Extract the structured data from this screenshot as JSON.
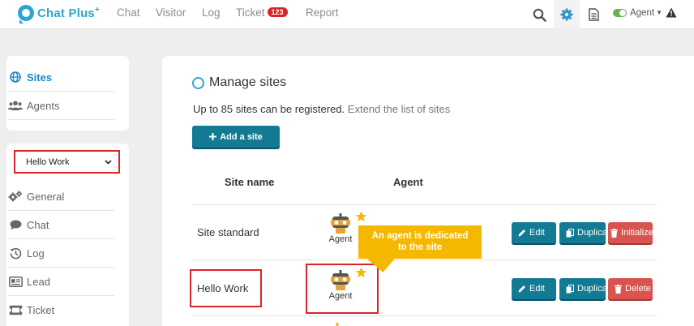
{
  "app": {
    "logo_text": "Chat Plus",
    "logo_sup": "+"
  },
  "nav": [
    {
      "label": "Chat"
    },
    {
      "label": "Visitor"
    },
    {
      "label": "Log"
    },
    {
      "label": "Ticket",
      "badge": "123"
    },
    {
      "label": "Report"
    }
  ],
  "toolbar": {
    "agent_label": "Agent",
    "icons": [
      "search-icon",
      "gear-icon",
      "document-icon",
      "warning-icon"
    ]
  },
  "sidebar_top": [
    {
      "label": "Sites",
      "icon": "globe-icon",
      "active": true
    },
    {
      "label": "Agents",
      "icon": "users-icon"
    }
  ],
  "site_select": {
    "value": "Hello Work"
  },
  "sidebar_menu": [
    {
      "label": "General",
      "icon": "gears-icon"
    },
    {
      "label": "Chat",
      "icon": "comment-icon"
    },
    {
      "label": "Log",
      "icon": "history-icon"
    },
    {
      "label": "Lead",
      "icon": "card-icon"
    },
    {
      "label": "Ticket",
      "icon": "ticket-icon"
    }
  ],
  "main": {
    "title": "Manage sites",
    "limit_text": "Up to 85 sites can be registered.",
    "limit_link": "Extend the list of sites",
    "add_button": "Add a site",
    "columns": {
      "site": "Site name",
      "agent": "Agent"
    },
    "rows": [
      {
        "site": "Site standard",
        "agent": "Agent",
        "actions": [
          "Edit",
          "Duplicate",
          "Initialize"
        ]
      },
      {
        "site": "Hello Work",
        "agent": "Agent",
        "actions": [
          "Edit",
          "Duplicate",
          "Delete"
        ]
      }
    ]
  },
  "callout": {
    "line1": "An agent is dedicated",
    "line2": "to the site"
  },
  "colors": {
    "brand": "#2aa7cf",
    "teal_button": "#137a93",
    "red_button": "#d9534f",
    "highlight": "#d9252a",
    "callout": "#f5b800"
  }
}
